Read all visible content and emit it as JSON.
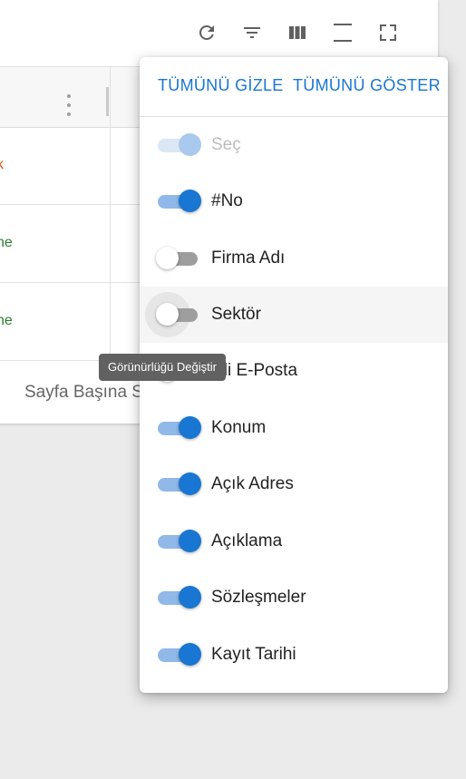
{
  "toolbar": {
    "icons": [
      "refresh-icon",
      "filter-icon",
      "columns-icon",
      "density-icon",
      "fullscreen-icon"
    ]
  },
  "table": {
    "rows": [
      {
        "text": "k",
        "color": "#e65100"
      },
      {
        "text": "ne",
        "color": "#2e7d32"
      },
      {
        "text": "ne",
        "color": "#2e7d32"
      }
    ],
    "header_partial": "I"
  },
  "footer": {
    "rows_per_page_label": "Sayfa Başına S"
  },
  "column_menu": {
    "hide_all_label": "TÜMÜNÜ GİZLE",
    "show_all_label": "TÜMÜNÜ GÖSTER",
    "items": [
      {
        "label": "Seç",
        "enabled": true,
        "disabled": true
      },
      {
        "label": "#No",
        "enabled": true,
        "disabled": false
      },
      {
        "label": "Firma Adı",
        "enabled": false,
        "disabled": false
      },
      {
        "label": "Sektör",
        "enabled": false,
        "disabled": false
      },
      {
        "label": "kili E-Posta",
        "enabled": false,
        "disabled": false
      },
      {
        "label": "Konum",
        "enabled": true,
        "disabled": false
      },
      {
        "label": "Açık Adres",
        "enabled": true,
        "disabled": false
      },
      {
        "label": "Açıklama",
        "enabled": true,
        "disabled": false
      },
      {
        "label": "Sözleşmeler",
        "enabled": true,
        "disabled": false
      },
      {
        "label": "Kayıt Tarihi",
        "enabled": true,
        "disabled": false
      }
    ]
  },
  "tooltip": {
    "text": "Görünürlüğü Değiştir"
  },
  "colors": {
    "accent": "#1976d2",
    "accent_track": "#90b8e8"
  }
}
